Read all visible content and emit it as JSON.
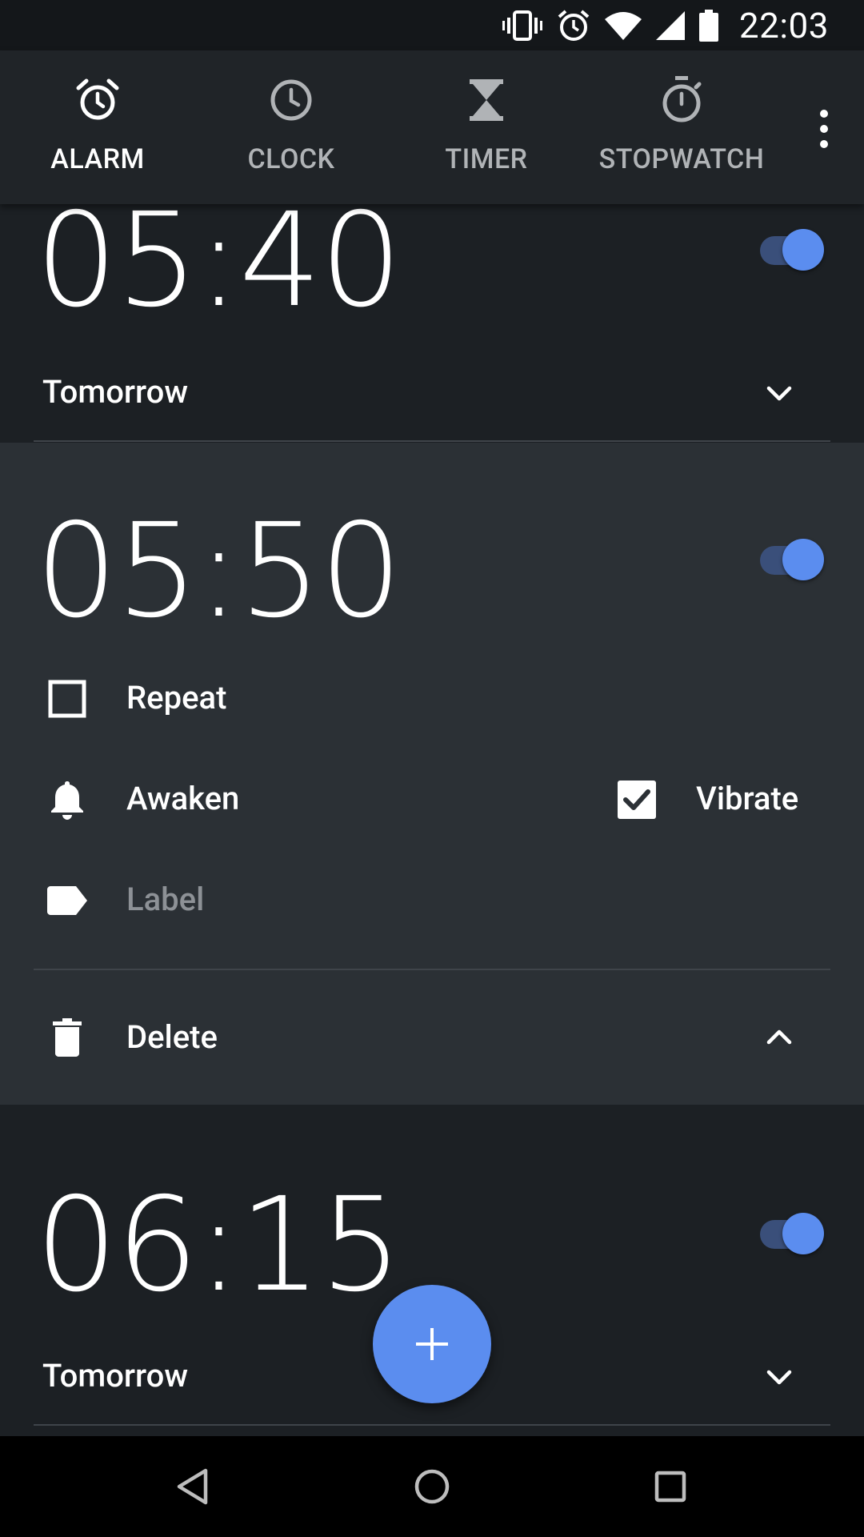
{
  "status_bar": {
    "time": "22:03",
    "icons": [
      "vibrate-icon",
      "alarm-icon",
      "wifi-icon",
      "signal-icon",
      "battery-icon"
    ]
  },
  "tabs": [
    {
      "label": "ALARM",
      "icon": "alarm-clock-icon",
      "active": true
    },
    {
      "label": "CLOCK",
      "icon": "clock-icon",
      "active": false
    },
    {
      "label": "TIMER",
      "icon": "hourglass-icon",
      "active": false
    },
    {
      "label": "STOPWATCH",
      "icon": "stopwatch-icon",
      "active": false
    }
  ],
  "alarms": [
    {
      "time": "05:40",
      "enabled": true,
      "day_label": "Tomorrow",
      "expanded": false
    },
    {
      "time": "05:50",
      "enabled": true,
      "expanded": true,
      "repeat_label": "Repeat",
      "repeat_checked": false,
      "ringtone": "Awaken",
      "vibrate_label": "Vibrate",
      "vibrate_checked": true,
      "label_placeholder": "Label",
      "delete_label": "Delete"
    },
    {
      "time": "06:15",
      "enabled": true,
      "day_label": "Tomorrow",
      "expanded": false
    }
  ],
  "colors": {
    "accent": "#5b8def",
    "toggle_track": "#3a4f7a",
    "background": "#1c2024",
    "expanded_card": "#2b3035",
    "tab_bar": "#202428"
  }
}
